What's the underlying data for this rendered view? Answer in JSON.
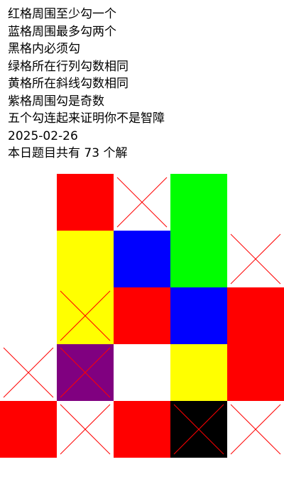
{
  "rules": [
    "红格周围至少勾一个",
    "蓝格周围最多勾两个",
    "黑格内必须勾",
    "绿格所在行列勾数相同",
    "黄格所在斜线勾数相同",
    "紫格周围勾是奇数",
    "五个勾连起来证明你不是智障",
    "2025-02-26",
    "本日题目共有 73 个解"
  ],
  "colors": {
    "red": "#ff0000",
    "blue": "#0000ff",
    "green": "#00ff00",
    "yellow": "#ffff00",
    "purple": "#800080",
    "black": "#000000",
    "empty": "#ffffff",
    "cross": "#ff0000"
  },
  "grid": [
    [
      "empty",
      "red",
      "empty-x",
      "green",
      "empty"
    ],
    [
      "empty",
      "yellow",
      "blue",
      "green",
      "empty-x"
    ],
    [
      "empty",
      "yellow-x",
      "red",
      "blue",
      "red"
    ],
    [
      "empty-x",
      "purple-x",
      "empty",
      "yellow",
      "red"
    ],
    [
      "red",
      "empty-x",
      "red",
      "black-x",
      "empty-x"
    ]
  ]
}
